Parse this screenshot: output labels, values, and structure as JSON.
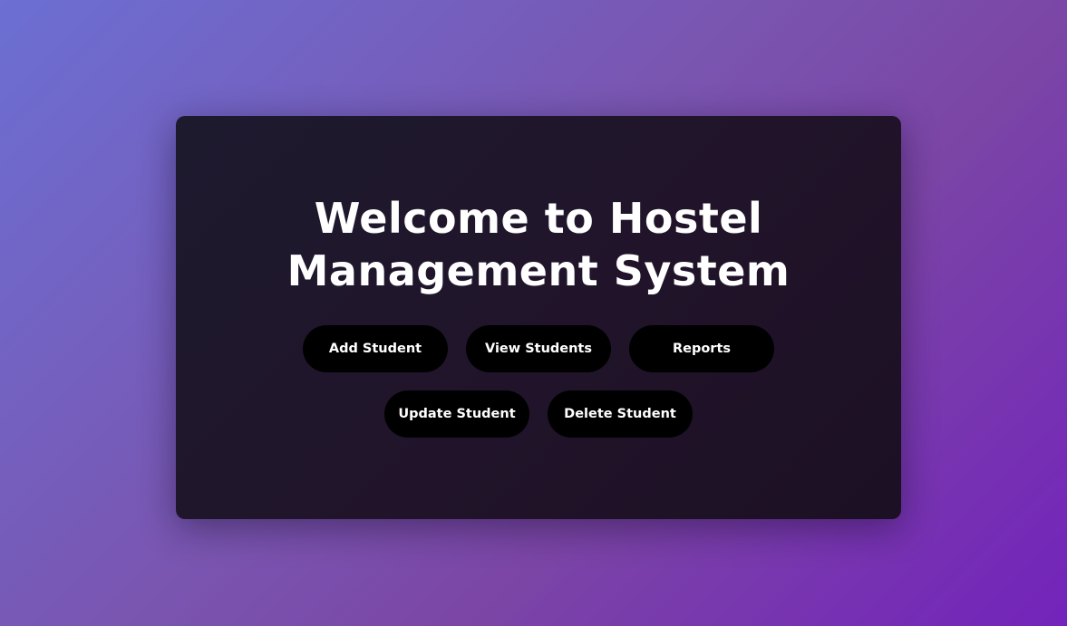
{
  "main": {
    "title_line1": "Welcome to Hostel",
    "title_line2": "Management System",
    "buttons": [
      {
        "label": "Add Student"
      },
      {
        "label": "View Students"
      },
      {
        "label": "Reports"
      },
      {
        "label": "Update Student"
      },
      {
        "label": "Delete Student"
      }
    ]
  },
  "colors": {
    "background_start": "#6c6fd3",
    "background_end": "#7323bb",
    "card": "#1f162b",
    "button": "#000000",
    "text": "#ffffff"
  }
}
